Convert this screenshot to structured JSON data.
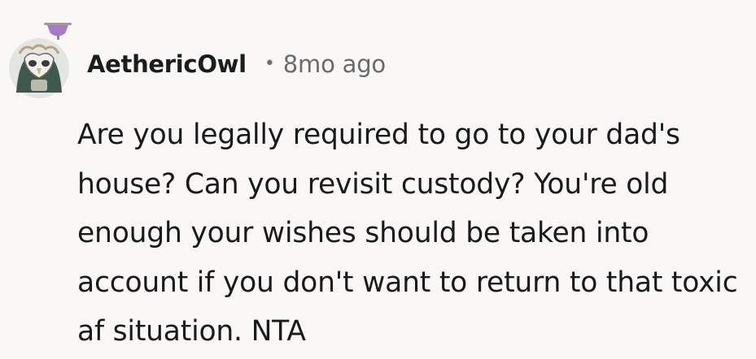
{
  "comment": {
    "author": "AethericOwl",
    "separator": "•",
    "timestamp": "8mo ago",
    "body": "Are you legally required to go to your dad's house? Can you revisit custody? You're old enough your wishes should be taken into account if you don't want to return to that toxic af situation. NTA"
  },
  "avatar": {
    "icon": "owl-avatar-icon",
    "accessory_icon": "goblet-icon",
    "colors": {
      "background": "#e4e6e3",
      "cloak": "#3d5a4c",
      "mask": "#f4f1ec",
      "goblet": "#a77bc8"
    }
  }
}
